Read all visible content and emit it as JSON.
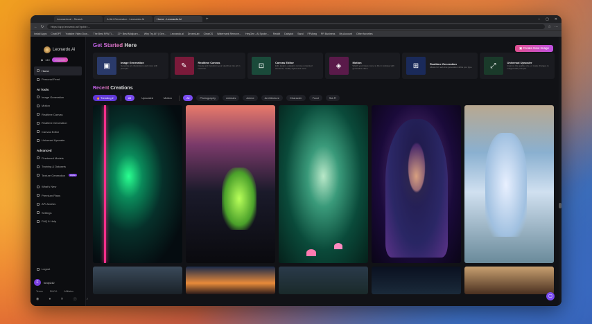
{
  "browser": {
    "tabs": [
      "Leonardo.ai - Search",
      "AI Art Generator - Leonardo.Ai",
      "Home - Leonardo.Ai"
    ],
    "url": "https://app.leonardo.ai/?gclid=...",
    "bookmarks": [
      "Install Apps",
      "ChatGPT",
      "Youtube Video Dow...",
      "The Best RPA Ti...",
      "27+ Best Midjourn...",
      "Why Try AI? | Gen...",
      "Leonardo.ai",
      "DreamLab",
      "ClearCS",
      "Watermark Remove...",
      "HeyGen - AI Spoke...",
      "Reddit",
      "Dailydot",
      "Saral",
      "FFMpeg",
      "PR Business",
      "My Account",
      "Other favorites"
    ]
  },
  "brand": {
    "name": "Leonardo.Ai"
  },
  "tokens": {
    "count": "140",
    "upgrade_label": "Upgrade"
  },
  "sidebar": {
    "top": [
      {
        "label": "Home"
      },
      {
        "label": "Personal Feed"
      }
    ],
    "ai_tools_header": "AI Tools",
    "ai_tools": [
      {
        "label": "Image Generation"
      },
      {
        "label": "Motion"
      },
      {
        "label": "Realtime Canvas"
      },
      {
        "label": "Realtime Generation"
      },
      {
        "label": "Canvas Editor"
      },
      {
        "label": "Universal Upscaler"
      }
    ],
    "advanced_header": "Advanced",
    "advanced": [
      {
        "label": "Finetuned Models"
      },
      {
        "label": "Training & Datasets"
      },
      {
        "label": "Texture Generation",
        "badge": "Alpha"
      }
    ],
    "misc": [
      {
        "label": "What's New"
      },
      {
        "label": "Premium Plans"
      },
      {
        "label": "API Access"
      },
      {
        "label": "Settings"
      },
      {
        "label": "FAQ & Help"
      }
    ],
    "logout": "Logout",
    "user": {
      "initial": "F",
      "name": "fordy242"
    },
    "links": [
      "Terms",
      "DMCA",
      "Affiliates"
    ]
  },
  "header": {
    "title_accent": "Get Started",
    "title_rest": "Here",
    "create_button": "Create New Image"
  },
  "tools": [
    {
      "title": "Image Generation",
      "desc": "Generate art, illustrations and more with prompts.",
      "color": "#2a3a6a",
      "glyph": "▣"
    },
    {
      "title": "Realtime Canvas",
      "desc": "Create and transform your sketches into art in real time.",
      "color": "#7a1a3a",
      "glyph": "✎"
    },
    {
      "title": "Canvas Editor",
      "desc": "Edit, inpaint, outpaint, remove unwanted elements, modify styles and more.",
      "color": "#1a4a3a",
      "glyph": "⊡"
    },
    {
      "title": "Motion",
      "desc": "Watch your ideas come to life in lockstep with generative video.",
      "color": "#5a1a4a",
      "glyph": "◈"
    },
    {
      "title": "Realtime Generation",
      "desc": "Allows for real-time generation while you type.",
      "color": "#1a2a5a",
      "glyph": "⊞"
    },
    {
      "title": "Universal Upscaler",
      "desc": "Improve the quality, size, or make changes to images with prompts.",
      "color": "#1a3a2a",
      "glyph": "⤢"
    }
  ],
  "recent": {
    "title_accent": "Recent",
    "title_rest": "Creations"
  },
  "filters": {
    "trending": "Trending",
    "view_tabs": [
      "All",
      "Upscaled",
      "Motion"
    ],
    "categories": [
      "All",
      "Photography",
      "Animals",
      "Anime",
      "Architecture",
      "Character",
      "Food",
      "Sci-Fi"
    ]
  }
}
